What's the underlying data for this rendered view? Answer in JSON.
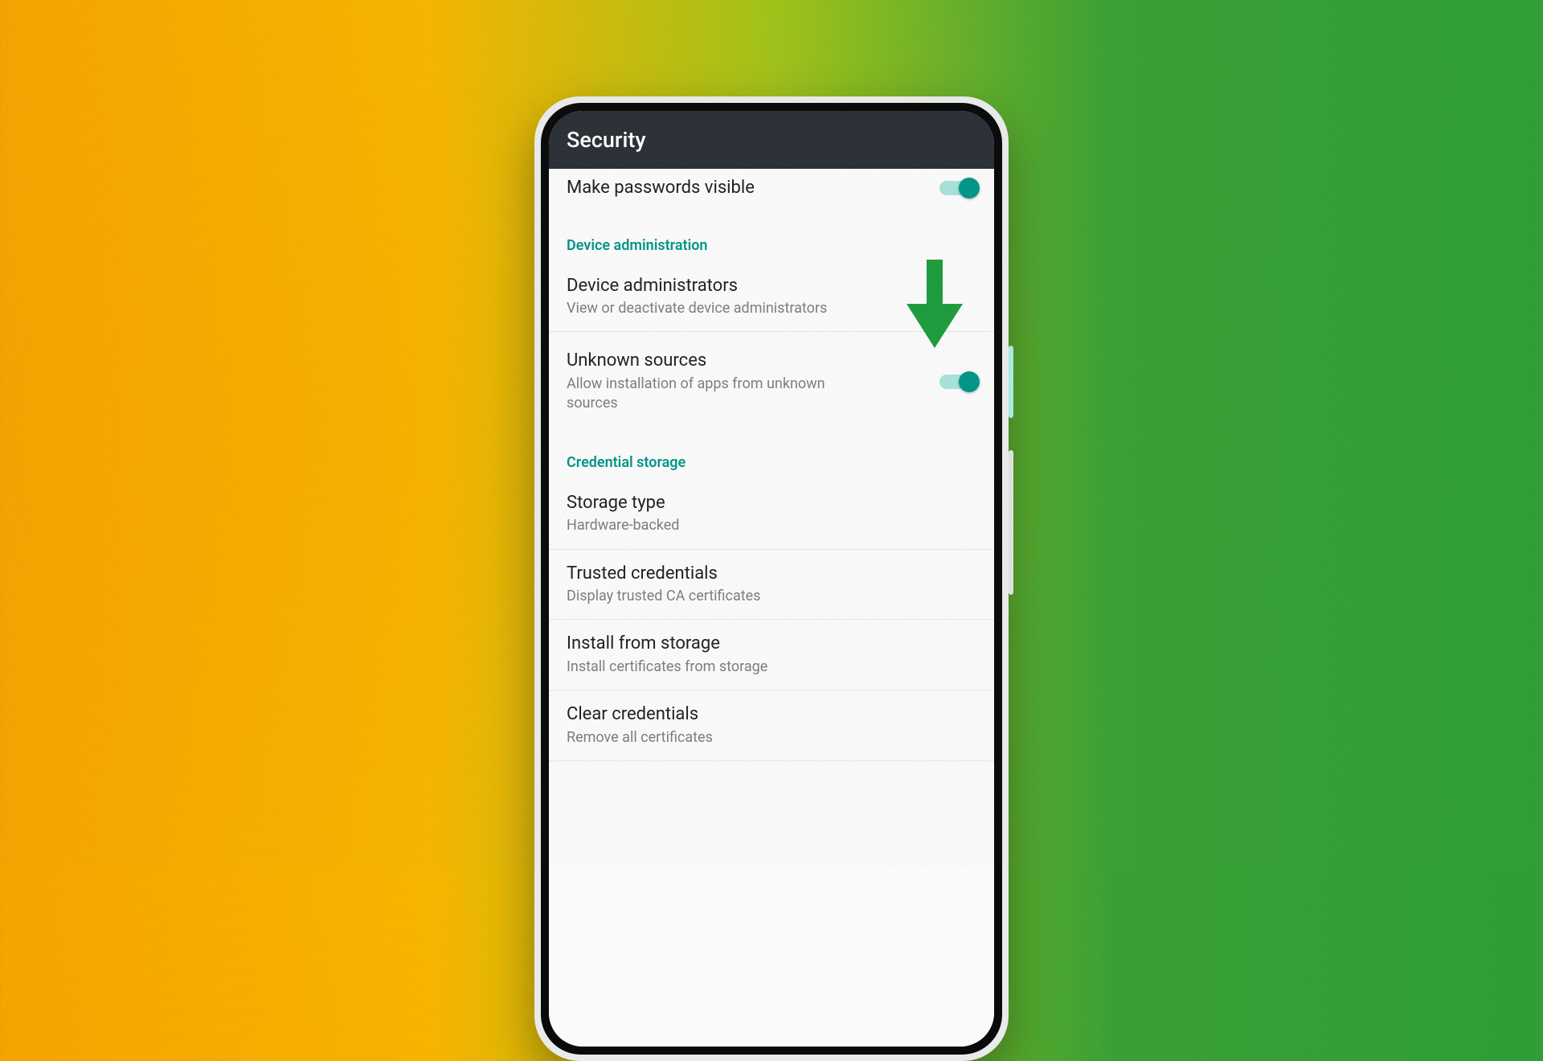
{
  "appbar": {
    "title": "Security"
  },
  "rows": {
    "passwords": {
      "title": "Make passwords visible"
    },
    "section_device": "Device administration",
    "device_admins": {
      "title": "Device administrators",
      "sub": "View or deactivate device administrators"
    },
    "unknown_sources": {
      "title": "Unknown sources",
      "sub": "Allow installation of apps from unknown sources"
    },
    "section_cred": "Credential storage",
    "storage_type": {
      "title": "Storage type",
      "sub": "Hardware-backed"
    },
    "trusted": {
      "title": "Trusted credentials",
      "sub": "Display trusted CA certificates"
    },
    "install": {
      "title": "Install from storage",
      "sub": "Install certificates from storage"
    },
    "clear": {
      "title": "Clear credentials",
      "sub": "Remove all certificates"
    }
  },
  "colors": {
    "accent": "#009688",
    "arrow": "#1d9c3d"
  }
}
